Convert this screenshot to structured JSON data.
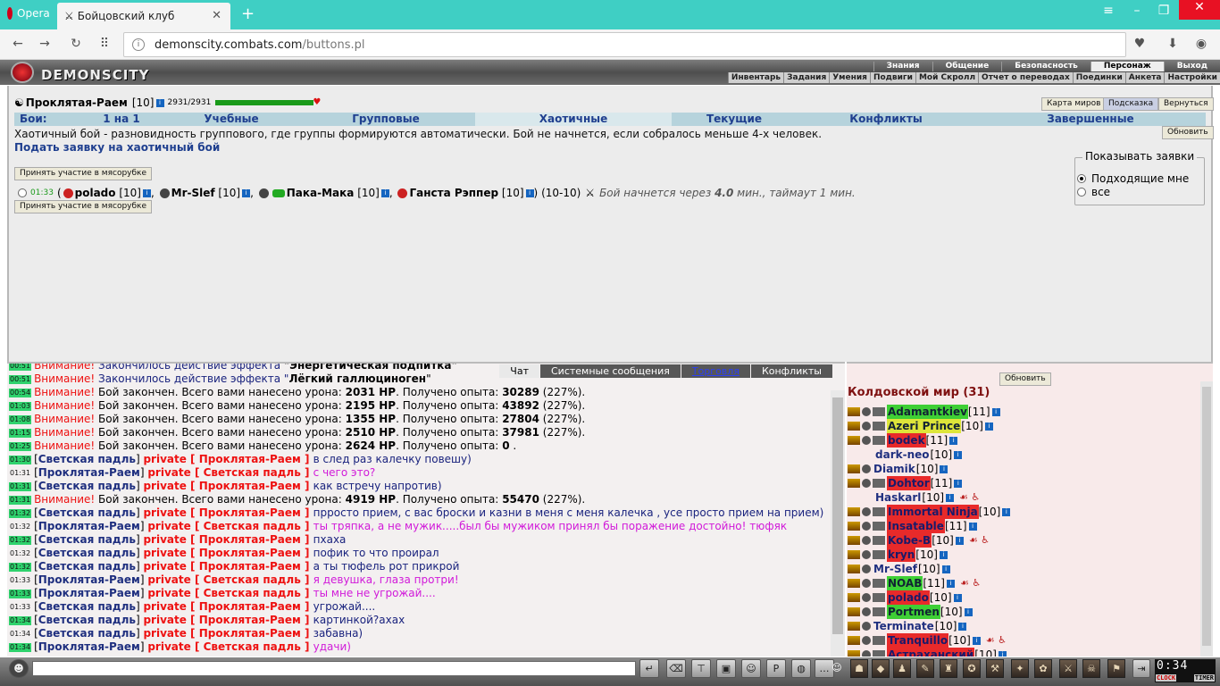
{
  "browser": {
    "menu_label": "Opera",
    "tab_title": "Бойцовский клуб",
    "url_host": "demonscity.combats.com",
    "url_path": "/buttons.pl"
  },
  "game": {
    "logo_text": "DEMONSCITY",
    "menu_top": [
      "Знания",
      "Общение",
      "Безопасность",
      "Персонаж",
      "Выход"
    ],
    "menu_top_active": "Персонаж",
    "menu_sub": [
      "Инвентарь",
      "Задания",
      "Умения",
      "Подвиги",
      "Мой Скролл",
      "Отчет о переводах",
      "Поединки",
      "Анкета",
      "Настройки"
    ]
  },
  "char": {
    "name": "Проклятая-Раем",
    "level": "[10]",
    "hp": "2931/2931",
    "hp_fraction": 1.0
  },
  "top_buttons": {
    "map": "Карта миров",
    "hint": "Подсказка",
    "back": "Вернуться",
    "refresh": "Обновить"
  },
  "tabs": {
    "label": "Бои:",
    "items": [
      "1 на 1",
      "Учебные",
      "Групповые",
      "Хаотичные",
      "Текущие",
      "Конфликты",
      "Завершенные"
    ],
    "active": "Хаотичные"
  },
  "chaos": {
    "description": "Хаотичный бой - разновидность группового, где группы формируются автоматически. Бой не начнется, если собралось меньше 4-х человек.",
    "create_link": "Подать заявку на хаотичный бой",
    "join_button": "Принять участие в мясорубке",
    "filter_legend": "Показывать заявки",
    "filter_options": [
      "Подходящие мне",
      "все"
    ],
    "filter_selected": 0,
    "bid": {
      "time": "01:33",
      "open": "(",
      "players": [
        {
          "name": "polado",
          "level": "[10]"
        },
        {
          "name": "Mr-Slef",
          "level": "[10]"
        },
        {
          "name": "Пака-Мака",
          "level": "[10]"
        },
        {
          "name": "Ганста Рэппер",
          "level": "[10]"
        }
      ],
      "close": ")",
      "range": "(10-10)",
      "start_text": "Бой начнется через",
      "start_value": "4.0",
      "start_rest": "мин., таймаут 1 мин."
    }
  },
  "chat": {
    "tabs": [
      "Чат",
      "Системные сообщения",
      "Торговля",
      "Конфликты"
    ],
    "active_tab": "Чат",
    "lines": [
      {
        "time": "00:51",
        "kind": "sys",
        "prefix": "Внимание!",
        "text": "Закончилось действие эффекта ",
        "bold": "\"Энергетическая подпитка\""
      },
      {
        "time": "00:51",
        "kind": "sys",
        "prefix": "Внимание!",
        "text": "Закончилось действие эффекта \"",
        "bold": "Лёгкий галлюциноген",
        "suffix": "\""
      },
      {
        "time": "00:54",
        "kind": "dmg",
        "prefix": "Внимание!",
        "dmg": "2031 HP",
        "exp": "30289",
        "pct": "(227%)."
      },
      {
        "time": "01:03",
        "kind": "dmg",
        "prefix": "Внимание!",
        "dmg": "2195 HP",
        "exp": "43892",
        "pct": "(227%)."
      },
      {
        "time": "01:08",
        "kind": "dmg",
        "prefix": "Внимание!",
        "dmg": "1355 HP",
        "exp": "27804",
        "pct": "(227%)."
      },
      {
        "time": "01:15",
        "kind": "dmg",
        "prefix": "Внимание!",
        "dmg": "2510 HP",
        "exp": "37981",
        "pct": "(227%)."
      },
      {
        "time": "01:25",
        "kind": "dmg",
        "prefix": "Внимание!",
        "dmg": "2624 HP",
        "exp": "0",
        "pct": "."
      },
      {
        "time": "01:30",
        "kind": "priv",
        "from": "Светская падль",
        "to": "Проклятая-Раем",
        "text": "в след раз калечку повешу)",
        "own": false
      },
      {
        "time": "01:31",
        "kind": "priv",
        "from": "Проклятая-Раем",
        "to": "Светская падль",
        "text": "с чего это?",
        "own": true
      },
      {
        "time": "01:31",
        "kind": "priv",
        "from": "Светская падль",
        "to": "Проклятая-Раем",
        "text": "как встречу напротив)",
        "own": false
      },
      {
        "time": "01:31",
        "kind": "dmg",
        "prefix": "Внимание!",
        "dmg": "4919 HP",
        "exp": "55470",
        "pct": "(227%)."
      },
      {
        "time": "01:32",
        "kind": "priv",
        "from": "Светская падль",
        "to": "Проклятая-Раем",
        "text": "прросто прием, с вас броски и казни в меня с меня калечка , усе просто прием на прием)",
        "own": false
      },
      {
        "time": "01:32",
        "kind": "priv",
        "from": "Проклятая-Раем",
        "to": "Светская падль",
        "text": "ты тряпка, а не мужик.....был бы мужиком принял бы поражение достойно! тюфяк",
        "own": true
      },
      {
        "time": "01:32",
        "kind": "priv",
        "from": "Светская падль",
        "to": "Проклятая-Раем",
        "text": "пхаха",
        "own": false
      },
      {
        "time": "01:32",
        "kind": "priv",
        "from": "Светская падль",
        "to": "Проклятая-Раем",
        "text": "пофик то что проирал",
        "own": false
      },
      {
        "time": "01:32",
        "kind": "priv",
        "from": "Светская падль",
        "to": "Проклятая-Раем",
        "text": "а ты тюфель рот прикрой",
        "own": false
      },
      {
        "time": "01:33",
        "kind": "priv",
        "from": "Проклятая-Раем",
        "to": "Светская падль",
        "text": "я девушка, глаза протри!",
        "own": true
      },
      {
        "time": "01:33",
        "kind": "priv",
        "from": "Проклятая-Раем",
        "to": "Светская падль",
        "text": "ты мне не угрожай....",
        "own": true
      },
      {
        "time": "01:33",
        "kind": "priv",
        "from": "Светская падль",
        "to": "Проклятая-Раем",
        "text": "угрожай....",
        "own": false
      },
      {
        "time": "01:34",
        "kind": "priv",
        "from": "Светская падль",
        "to": "Проклятая-Раем",
        "text": "картинкой?ахах",
        "own": false
      },
      {
        "time": "01:34",
        "kind": "priv",
        "from": "Светская падль",
        "to": "Проклятая-Раем",
        "text": "забавна)",
        "own": false
      },
      {
        "time": "01:34",
        "kind": "priv",
        "from": "Проклятая-Раем",
        "to": "Светская падль",
        "text": "удачи)",
        "own": true
      }
    ],
    "labels": {
      "private": "private",
      "dmg_pre": "Бой закончен. Всего вами нанесено урона:",
      "exp_pre": ". Получено опыта:"
    }
  },
  "online": {
    "refresh": "Обновить",
    "world_title": "Колдовской мир (31)",
    "users": [
      {
        "name": "Adamantkiev",
        "level": "[11]",
        "hl": "grn",
        "icons": 2,
        "trauma": false
      },
      {
        "name": "Azeri Prince",
        "level": "[10]",
        "hl": "yel",
        "icons": 2,
        "trauma": false
      },
      {
        "name": "bodek",
        "level": "[11]",
        "hl": "red",
        "icons": 2,
        "trauma": false
      },
      {
        "name": "dark-neo",
        "level": "[10]",
        "hl": "",
        "icons": 0,
        "trauma": false
      },
      {
        "name": "Diamik",
        "level": "[10]",
        "hl": "",
        "icons": 1,
        "trauma": false
      },
      {
        "name": "Dohtor",
        "level": "[11]",
        "hl": "red",
        "icons": 2,
        "trauma": false
      },
      {
        "name": "Haskarl",
        "level": "[10]",
        "hl": "",
        "icons": 0,
        "trauma": true
      },
      {
        "name": "Immortal Ninja",
        "level": "[10]",
        "hl": "red",
        "icons": 2,
        "trauma": false
      },
      {
        "name": "Insatable",
        "level": "[11]",
        "hl": "red",
        "icons": 2,
        "trauma": false
      },
      {
        "name": "Kobe-B",
        "level": "[10]",
        "hl": "red",
        "icons": 2,
        "trauma": true
      },
      {
        "name": "kryn",
        "level": "[10]",
        "hl": "red",
        "icons": 2,
        "trauma": false
      },
      {
        "name": "Mr-Slef",
        "level": "[10]",
        "hl": "",
        "icons": 1,
        "trauma": false
      },
      {
        "name": "NOAB",
        "level": "[11]",
        "hl": "grn",
        "icons": 2,
        "trauma": true
      },
      {
        "name": "polado",
        "level": "[10]",
        "hl": "red",
        "icons": 2,
        "trauma": false
      },
      {
        "name": "Portmen",
        "level": "[10]",
        "hl": "grn",
        "icons": 2,
        "trauma": false
      },
      {
        "name": "Terminate",
        "level": "[10]",
        "hl": "",
        "icons": 1,
        "trauma": false
      },
      {
        "name": "Tranquillo",
        "level": "[10]",
        "hl": "red",
        "icons": 2,
        "trauma": true
      },
      {
        "name": "Астраханский",
        "level": "[10]",
        "hl": "red",
        "icons": 2,
        "trauma": false
      }
    ]
  },
  "bottom": {
    "clock": "0:34",
    "clock_label": "CLOCK",
    "timer_label": "TIMER"
  }
}
